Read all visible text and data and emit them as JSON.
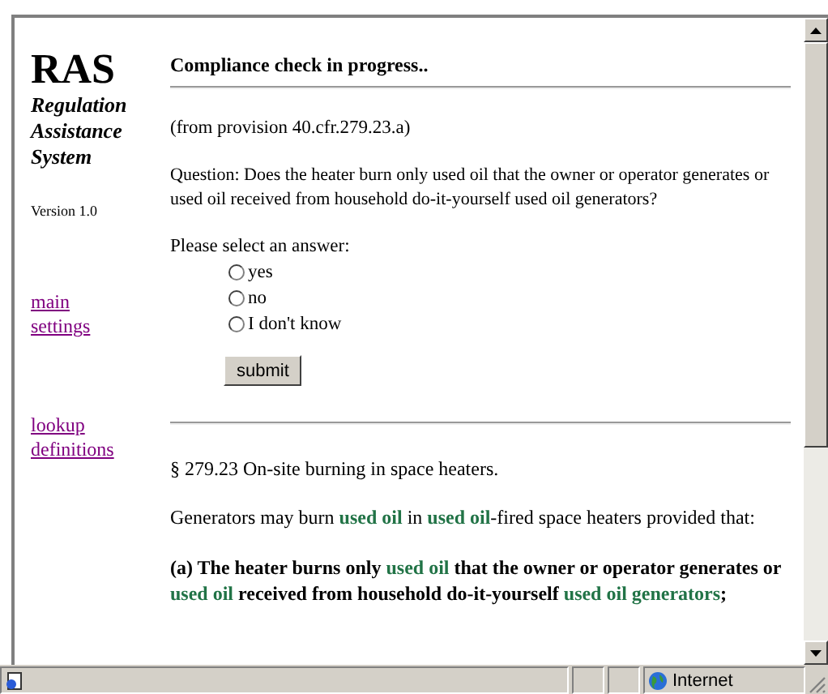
{
  "sidebar": {
    "logo": "RAS",
    "subtitle": [
      "Regulation",
      "Assistance",
      "System"
    ],
    "version": "Version 1.0",
    "link_groups": [
      [
        "main",
        "settings"
      ],
      [
        "lookup",
        "definitions"
      ]
    ]
  },
  "main": {
    "heading": "Compliance check in progress..",
    "provision": "(from provision 40.cfr.279.23.a)",
    "question": "Question: Does the heater burn only used oil that the owner or operator generates or used oil received from household do-it-yourself used oil generators?",
    "prompt": "Please select an answer:",
    "options": [
      {
        "label": "yes",
        "selected": false
      },
      {
        "label": "no",
        "selected": false
      },
      {
        "label": "I don't know",
        "selected": false
      }
    ],
    "submit": "submit",
    "section_title": "§ 279.23 On-site burning in space heaters.",
    "paragraphs": [
      {
        "bold": false,
        "segments": [
          {
            "text": "Generators may burn ",
            "term": false
          },
          {
            "text": "used oil",
            "term": true
          },
          {
            "text": " in ",
            "term": false
          },
          {
            "text": "used oil",
            "term": true
          },
          {
            "text": "-fired space heaters provided that:",
            "term": false
          }
        ]
      },
      {
        "bold": true,
        "segments": [
          {
            "text": "(a) The heater burns only ",
            "term": false
          },
          {
            "text": "used oil",
            "term": true
          },
          {
            "text": " that the owner or operator generates or ",
            "term": false
          },
          {
            "text": "used oil",
            "term": true
          },
          {
            "text": " received from household do-it-yourself ",
            "term": false
          },
          {
            "text": "used oil generators",
            "term": true
          },
          {
            "text": ";",
            "term": false
          }
        ]
      }
    ]
  },
  "status_bar": {
    "zone": "Internet"
  }
}
